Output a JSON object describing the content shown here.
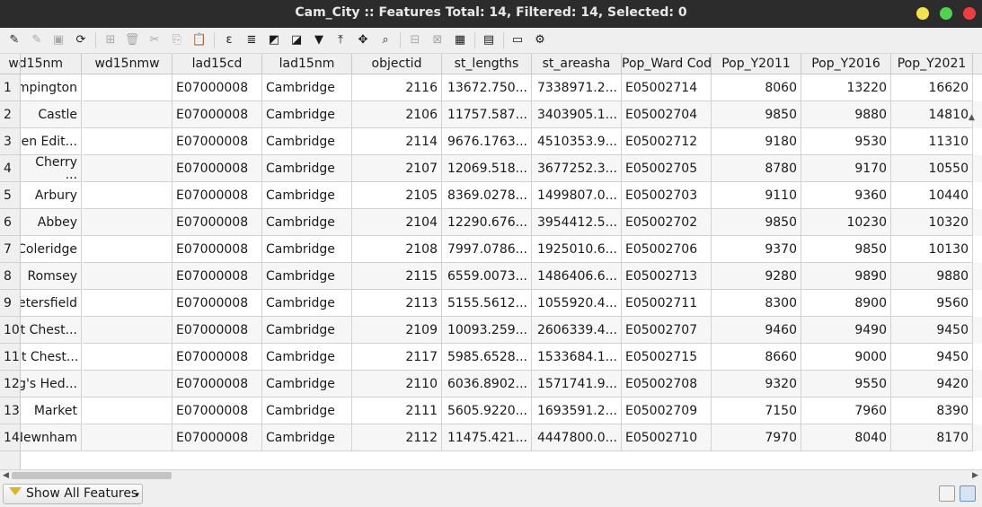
{
  "window": {
    "title": "Cam_City :: Features Total: 14, Filtered: 14, Selected: 0"
  },
  "toolbar": {
    "icons": [
      {
        "name": "toggle-editing-icon",
        "glyph": "✎",
        "enabled": true
      },
      {
        "name": "toggle-multi-edit-icon",
        "glyph": "✎",
        "enabled": false
      },
      {
        "name": "save-edits-icon",
        "glyph": "▣",
        "enabled": false
      },
      {
        "name": "reload-table-icon",
        "glyph": "⟳",
        "enabled": true
      },
      {
        "name": "add-feature-icon",
        "glyph": "⊞",
        "enabled": false
      },
      {
        "name": "delete-feature-icon",
        "glyph": "🗑",
        "enabled": false
      },
      {
        "name": "cut-icon",
        "glyph": "✂",
        "enabled": false
      },
      {
        "name": "copy-icon",
        "glyph": "⎘",
        "enabled": false
      },
      {
        "name": "paste-icon",
        "glyph": "📋",
        "enabled": false
      },
      {
        "name": "select-by-expression-icon",
        "glyph": "ε",
        "enabled": true
      },
      {
        "name": "select-all-icon",
        "glyph": "≣",
        "enabled": true
      },
      {
        "name": "invert-selection-icon",
        "glyph": "◩",
        "enabled": true
      },
      {
        "name": "deselect-all-icon",
        "glyph": "◪",
        "enabled": true
      },
      {
        "name": "filter-select-icon",
        "glyph": "▼",
        "enabled": true
      },
      {
        "name": "move-selection-to-top-icon",
        "glyph": "⤒",
        "enabled": true
      },
      {
        "name": "pan-to-selected-icon",
        "glyph": "✥",
        "enabled": true
      },
      {
        "name": "zoom-to-selected-icon",
        "glyph": "⌕",
        "enabled": true
      },
      {
        "name": "new-field-icon",
        "glyph": "⊟",
        "enabled": false
      },
      {
        "name": "delete-field-icon",
        "glyph": "⊠",
        "enabled": false
      },
      {
        "name": "field-calculator-icon",
        "glyph": "▦",
        "enabled": true
      },
      {
        "name": "conditional-formatting-icon",
        "glyph": "▤",
        "enabled": true
      },
      {
        "name": "dock-table-icon",
        "glyph": "▭",
        "enabled": true
      },
      {
        "name": "actions-icon",
        "glyph": "⚙",
        "enabled": true
      }
    ]
  },
  "table": {
    "row_header_label": "",
    "columns": [
      "wd15nm",
      "wd15nmw",
      "lad15cd",
      "lad15nm",
      "objectid",
      "st_lengths",
      "st_areasha",
      "Pop_Ward Code",
      "Pop_Y2011",
      "Pop_Y2016",
      "Pop_Y2021"
    ],
    "rows": [
      [
        "1",
        "Trumpington",
        "",
        "E07000008",
        "Cambridge",
        "2116",
        "13672.750...",
        "7338971.2...",
        "E05002714",
        "8060",
        "13220",
        "16620"
      ],
      [
        "2",
        "Castle",
        "",
        "E07000008",
        "Cambridge",
        "2106",
        "11757.587...",
        "3403905.1...",
        "E05002704",
        "9850",
        "9880",
        "14810"
      ],
      [
        "3",
        "Queen Edit...",
        "",
        "E07000008",
        "Cambridge",
        "2114",
        "9676.1763...",
        "4510353.9...",
        "E05002712",
        "9180",
        "9530",
        "11310"
      ],
      [
        "4",
        "Cherry\n...",
        "",
        "E07000008",
        "Cambridge",
        "2107",
        "12069.518...",
        "3677252.3...",
        "E05002705",
        "8780",
        "9170",
        "10550"
      ],
      [
        "5",
        "Arbury",
        "",
        "E07000008",
        "Cambridge",
        "2105",
        "8369.0278...",
        "1499807.0...",
        "E05002703",
        "9110",
        "9360",
        "10440"
      ],
      [
        "6",
        "Abbey",
        "",
        "E07000008",
        "Cambridge",
        "2104",
        "12290.676...",
        "3954412.5...",
        "E05002702",
        "9850",
        "10230",
        "10320"
      ],
      [
        "7",
        "Coleridge",
        "",
        "E07000008",
        "Cambridge",
        "2108",
        "7997.0786...",
        "1925010.6...",
        "E05002706",
        "9370",
        "9850",
        "10130"
      ],
      [
        "8",
        "Romsey",
        "",
        "E07000008",
        "Cambridge",
        "2115",
        "6559.0073...",
        "1486406.6...",
        "E05002713",
        "9280",
        "9890",
        "9880"
      ],
      [
        "9",
        "Petersfield",
        "",
        "E07000008",
        "Cambridge",
        "2113",
        "5155.5612...",
        "1055920.4...",
        "E05002711",
        "8300",
        "8900",
        "9560"
      ],
      [
        "10",
        "East Chest...",
        "",
        "E07000008",
        "Cambridge",
        "2109",
        "10093.259...",
        "2606339.4...",
        "E05002707",
        "9460",
        "9490",
        "9450"
      ],
      [
        "11",
        "West Chest...",
        "",
        "E07000008",
        "Cambridge",
        "2117",
        "5985.6528...",
        "1533684.1...",
        "E05002715",
        "8660",
        "9000",
        "9450"
      ],
      [
        "12",
        "King's Hed...",
        "",
        "E07000008",
        "Cambridge",
        "2110",
        "6036.8902...",
        "1571741.9...",
        "E05002708",
        "9320",
        "9550",
        "9420"
      ],
      [
        "13",
        "Market",
        "",
        "E07000008",
        "Cambridge",
        "2111",
        "5605.9220...",
        "1693591.2...",
        "E05002709",
        "7150",
        "7960",
        "8390"
      ],
      [
        "14",
        "Newnham",
        "",
        "E07000008",
        "Cambridge",
        "2112",
        "11475.421...",
        "4447800.0...",
        "E05002710",
        "7970",
        "8040",
        "8170"
      ]
    ]
  },
  "footer": {
    "filter_label": "Show All Features",
    "form_view_icon": "form-view-icon",
    "table_view_icon": "table-view-icon"
  }
}
